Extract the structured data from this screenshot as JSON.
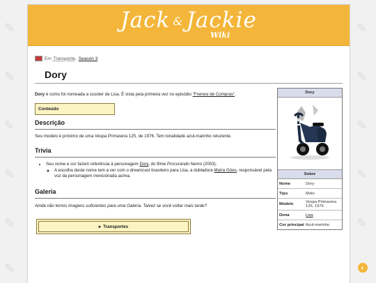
{
  "logo": {
    "part1": "Jack",
    "amp": "&",
    "part2": "Jackie",
    "sub": "Wiki"
  },
  "breadcrumb": {
    "prefix": "Em",
    "category": "Transporte",
    "separator": ",",
    "season": "Season 3"
  },
  "page_title": "Dory",
  "intro": {
    "subject": "Dory",
    "text_before_link": " é como foi nomeada a scooter de Lisa. É vista pela primeira vez no episódio ",
    "link": "\"Frenesi de Compras\"",
    "text_after_link": "."
  },
  "toc": {
    "label": "Conteúdo"
  },
  "sections": {
    "descricao": {
      "heading": "Descrição",
      "text": "Seu modelo é próximo de uma Vespa Primavera 125, de 1976. Tem tonalidade azul-marinho reluzente."
    },
    "trivia": {
      "heading": "Trivia",
      "item1_before": "Seu nome e cor fazem referência à personagem ",
      "item1_link": "Dory",
      "item1_mid": ", do filme ",
      "item1_film": "Procurando Nemo",
      "item1_after": " (2003).",
      "sub_before": "A escolha deste nome tem a ver com o ",
      "sub_em": "dreamcast",
      "sub_mid": " brasileiro para Lisa, a dubladora ",
      "sub_link": "Maíra Góes",
      "sub_after": ", responsável pela voz da personagem mencionada acima."
    },
    "galeria": {
      "heading": "Galeria",
      "text": "Ainda não temos imagens suficientes para uma Galeria. Talvez se você voltar mais tarde?"
    }
  },
  "gallery_nav": {
    "arrow": "▸",
    "label": "Transportes"
  },
  "infobox": {
    "title": "Dory",
    "section": "Sobre",
    "rows": [
      {
        "key": "Nome",
        "value": "Dory"
      },
      {
        "key": "Tipo",
        "value": "Moto"
      },
      {
        "key": "Modelo",
        "value": "Vespa Primavera 125, 1976"
      },
      {
        "key": "Dona",
        "value": "Lisa"
      },
      {
        "key": "Cor principal",
        "value": "Azul-marinho"
      }
    ]
  },
  "theme_toggle": {
    "icon": "◐"
  },
  "colors": {
    "banner": "#f4b63a",
    "box_bg": "#fdf4c4",
    "infobox_header": "#d9dcea"
  },
  "icons": [
    "flag-icon",
    "scooter-image",
    "feather-icon",
    "theme-toggle-icon"
  ]
}
